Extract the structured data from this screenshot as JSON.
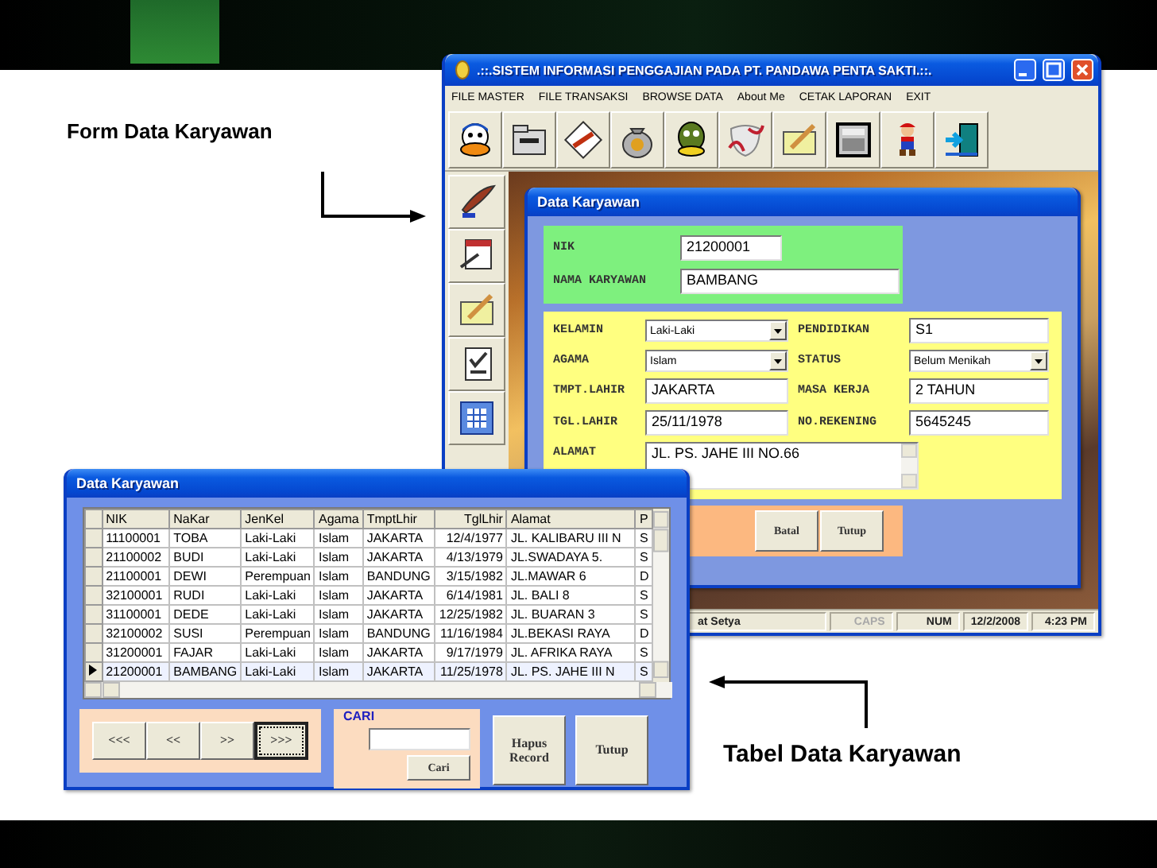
{
  "captions": [
    {
      "text": "Form Data Karyawan"
    },
    {
      "text": "Tabel Data Karyawan"
    }
  ],
  "app_window": {
    "title": ".::.SISTEM INFORMASI PENGGAJIAN PADA PT. PANDAWA PENTA SAKTI.::.",
    "menu": [
      "FILE MASTER",
      "FILE TRANSAKSI",
      "BROWSE DATA",
      "About Me",
      "CETAK LAPORAN",
      "EXIT"
    ],
    "status_bar": [
      {
        "text": "at Setya",
        "disabled": false
      },
      {
        "text": "CAPS",
        "disabled": true
      },
      {
        "text": "NUM",
        "disabled": false
      },
      {
        "text": "12/2/2008",
        "disabled": false
      },
      {
        "text": "4:23 PM",
        "disabled": false
      }
    ]
  },
  "form_window": {
    "title": "Data Karyawan",
    "header_fields": [
      {
        "label": "NIK",
        "value": "21200001"
      },
      {
        "label": "NAMA KARYAWAN",
        "value": "BAMBANG"
      }
    ],
    "detail_fields": [
      {
        "kind": "combo",
        "label": "KELAMIN",
        "value": "Laki-Laki"
      },
      {
        "kind": "text",
        "label": "PENDIDIKAN",
        "value": "S1"
      },
      {
        "kind": "combo",
        "label": "AGAMA",
        "value": "Islam"
      },
      {
        "kind": "combo",
        "label": "STATUS",
        "value": "Belum Menikah"
      },
      {
        "kind": "text",
        "label": "TMPT.LAHIR",
        "value": "JAKARTA"
      },
      {
        "kind": "text",
        "label": "MASA KERJA",
        "value": "2 TAHUN"
      },
      {
        "kind": "text",
        "label": "TGL.LAHIR",
        "value": "25/11/1978"
      },
      {
        "kind": "text",
        "label": "NO.REKENING",
        "value": "5645245"
      },
      {
        "kind": "memo",
        "label": "ALAMAT",
        "value": "JL. PS. JAHE III NO.66"
      }
    ],
    "buttons": [
      "Batal",
      "Tutup"
    ]
  },
  "table_window": {
    "title": "Data Karyawan",
    "columns": [
      "NIK",
      "NaKar",
      "JenKel",
      "Agama",
      "TmptLhir",
      "TglLhir",
      "Alamat",
      "P"
    ],
    "rows": [
      {
        "cells": [
          "11100001",
          "TOBA",
          "Laki-Laki",
          "Islam",
          "JAKARTA",
          "12/4/1977",
          "JL. KALIBARU III N",
          "S"
        ],
        "selected": false
      },
      {
        "cells": [
          "21100002",
          "BUDI",
          "Laki-Laki",
          "Islam",
          "JAKARTA",
          "4/13/1979",
          "JL.SWADAYA 5.",
          "S"
        ],
        "selected": false
      },
      {
        "cells": [
          "21100001",
          "DEWI",
          "Perempuan",
          "Islam",
          "BANDUNG",
          "3/15/1982",
          "JL.MAWAR 6",
          "D"
        ],
        "selected": false
      },
      {
        "cells": [
          "32100001",
          "RUDI",
          "Laki-Laki",
          "Islam",
          "JAKARTA",
          "6/14/1981",
          "JL. BALI 8",
          "S"
        ],
        "selected": false
      },
      {
        "cells": [
          "31100001",
          "DEDE",
          "Laki-Laki",
          "Islam",
          "JAKARTA",
          "12/25/1982",
          "JL. BUARAN 3",
          "S"
        ],
        "selected": false
      },
      {
        "cells": [
          "32100002",
          "SUSI",
          "Perempuan",
          "Islam",
          "BANDUNG",
          "11/16/1984",
          "JL.BEKASI RAYA",
          "D"
        ],
        "selected": false
      },
      {
        "cells": [
          "31200001",
          "FAJAR",
          "Laki-Laki",
          "Islam",
          "JAKARTA",
          "9/17/1979",
          "JL. AFRIKA RAYA",
          "S"
        ],
        "selected": false
      },
      {
        "cells": [
          "21200001",
          "BAMBANG",
          "Laki-Laki",
          "Islam",
          "JAKARTA",
          "11/25/1978",
          "JL. PS. JAHE III N",
          "S"
        ],
        "selected": true
      }
    ],
    "nav_buttons": [
      {
        "label": "<<<",
        "focused": false
      },
      {
        "label": "<<",
        "focused": false
      },
      {
        "label": ">>",
        "focused": false
      },
      {
        "label": ">>>",
        "focused": true
      }
    ],
    "search": {
      "title": "CARI",
      "button": "Cari"
    },
    "buttons": [
      "Hapus Record",
      "Tutup"
    ]
  }
}
